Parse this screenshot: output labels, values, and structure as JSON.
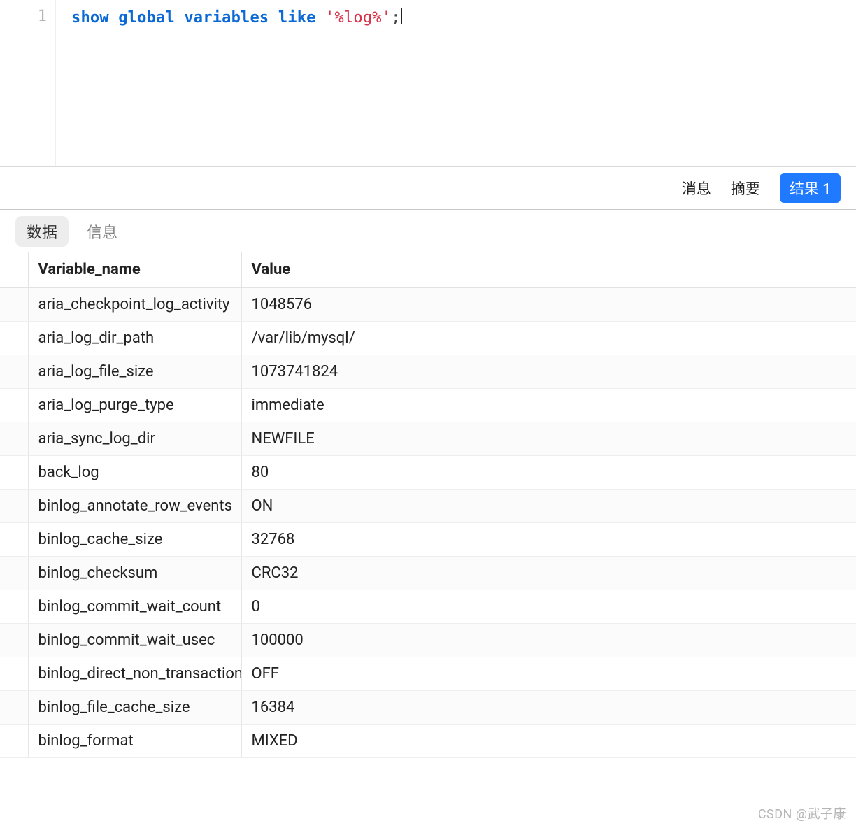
{
  "editor": {
    "line_number": "1",
    "tokens": {
      "kw1": "show",
      "kw2": "global",
      "kw3": "variables",
      "kw4": "like",
      "str": "'%log%'",
      "pun": ";"
    }
  },
  "toolbar": {
    "msg": "消息",
    "summary": "摘要",
    "result": "结果 1"
  },
  "subtabs": {
    "data": "数据",
    "info": "信息"
  },
  "columns": {
    "name": "Variable_name",
    "value": "Value"
  },
  "rows": [
    {
      "name": "aria_checkpoint_log_activity",
      "value": "1048576"
    },
    {
      "name": "aria_log_dir_path",
      "value": "/var/lib/mysql/"
    },
    {
      "name": "aria_log_file_size",
      "value": "1073741824"
    },
    {
      "name": "aria_log_purge_type",
      "value": "immediate"
    },
    {
      "name": "aria_sync_log_dir",
      "value": "NEWFILE"
    },
    {
      "name": "back_log",
      "value": "80"
    },
    {
      "name": "binlog_annotate_row_events",
      "value": "ON"
    },
    {
      "name": "binlog_cache_size",
      "value": "32768"
    },
    {
      "name": "binlog_checksum",
      "value": "CRC32"
    },
    {
      "name": "binlog_commit_wait_count",
      "value": "0"
    },
    {
      "name": "binlog_commit_wait_usec",
      "value": "100000"
    },
    {
      "name": "binlog_direct_non_transactional_updates",
      "value": "OFF"
    },
    {
      "name": "binlog_file_cache_size",
      "value": "16384"
    },
    {
      "name": "binlog_format",
      "value": "MIXED"
    }
  ],
  "watermark": "CSDN @武子康"
}
